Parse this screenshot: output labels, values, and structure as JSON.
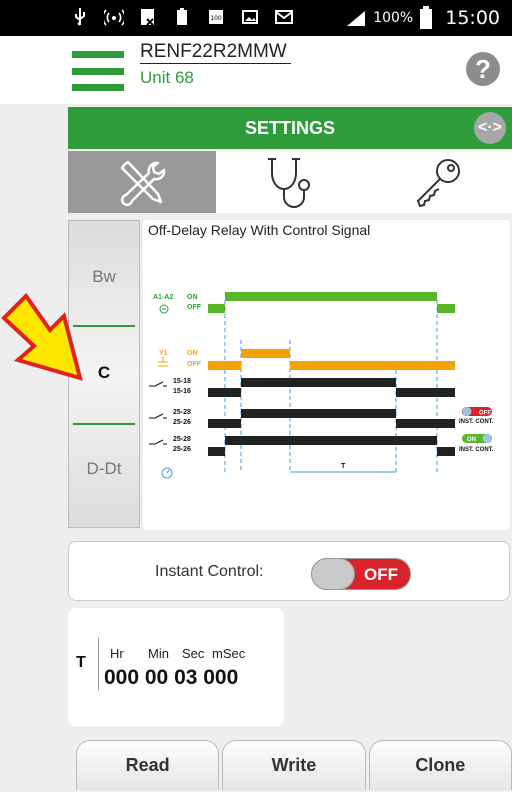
{
  "status_bar": {
    "battery_pct": "100%",
    "time": "15:00"
  },
  "header": {
    "device_name": "RENF22R2MMW",
    "unit": "Unit 68",
    "help": "?"
  },
  "settings": {
    "title": "SETTINGS",
    "swap_icon": "<·>"
  },
  "tabs": [
    {
      "icon": "tools-icon",
      "active": true
    },
    {
      "icon": "stethoscope-icon",
      "active": false
    },
    {
      "icon": "key-icon",
      "active": false
    }
  ],
  "modes": [
    {
      "label": "Bw",
      "selected": false
    },
    {
      "label": "C",
      "selected": true
    },
    {
      "label": "D-Dt",
      "selected": false
    }
  ],
  "diagram": {
    "title": "Off-Delay Relay With Control Signal",
    "signals": {
      "a1a2": "A1-A2",
      "y1": "Y1",
      "on": "ON",
      "off": "OFF",
      "c1_top": "15-18",
      "c1_bot": "15-16",
      "c2_top": "25-28",
      "c2_bot": "25-26",
      "c3_top": "25-28",
      "c3_bot": "25-26",
      "t_label": "T"
    },
    "badges": {
      "off_badge": "OFF",
      "on_badge": "ON",
      "inst_cont": "INST. CONT."
    }
  },
  "instant_control": {
    "label": "Instant Control:",
    "state": "OFF"
  },
  "timer": {
    "label": "T",
    "units": {
      "hr": "Hr",
      "min": "Min",
      "sec": "Sec",
      "msec": "mSec"
    },
    "value": "000 00 03 000"
  },
  "buttons": {
    "read": "Read",
    "write": "Write",
    "clone": "Clone"
  },
  "colors": {
    "green": "#2e9c3a",
    "orange": "#f5a20a",
    "red": "#d8232a",
    "dashed": "#3aa0e0"
  }
}
